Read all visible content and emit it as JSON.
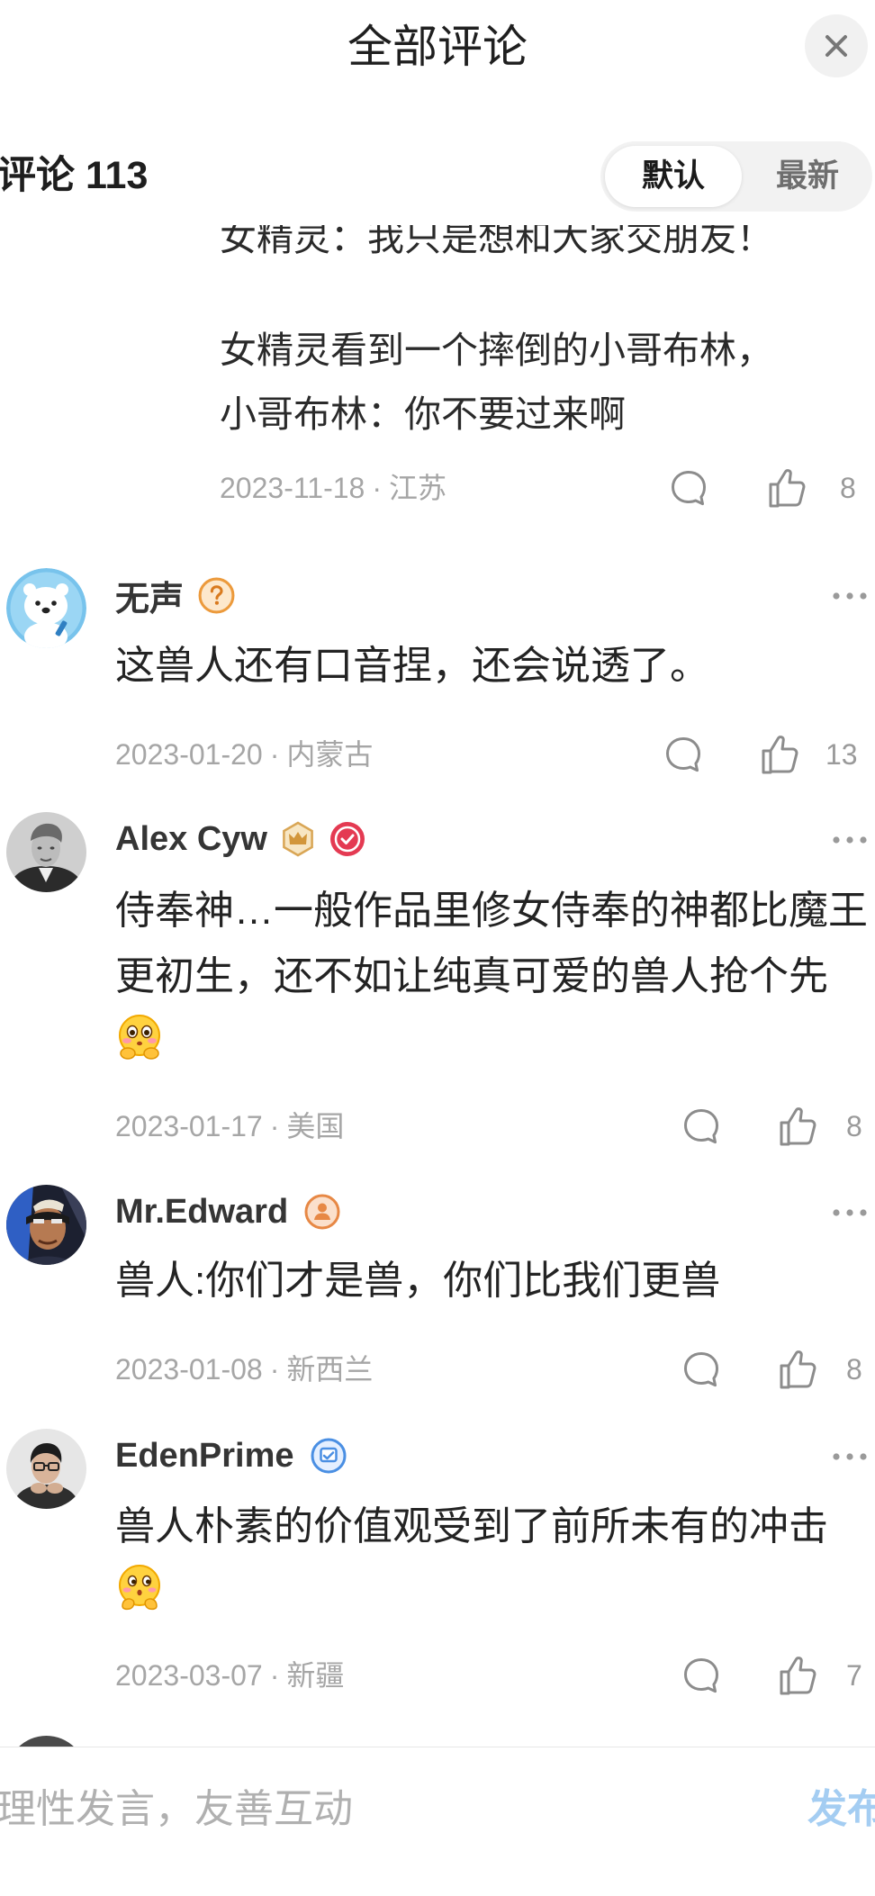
{
  "header": {
    "title": "全部评论",
    "close_icon": "close-icon"
  },
  "comments_bar": {
    "label": "评论",
    "count": "113",
    "sort_options": [
      "默认",
      "最新"
    ],
    "active_sort_index": 0
  },
  "meta_separator": "·",
  "icons": {
    "reply": "comment-bubble-icon",
    "like": "thumbs-up-icon",
    "more": "more-dots-icon"
  },
  "top_reply": {
    "lines": [
      "女精灵：我只是想和大家交朋友！",
      "女精灵看到一个摔倒的小哥布林，",
      "小哥布林：你不要过来啊"
    ],
    "date": "2023-11-18",
    "location": "江苏",
    "likes": "8"
  },
  "comments": [
    {
      "user": "无声",
      "avatar_icon": "polar-bear-avatar",
      "badges": [
        "question-badge-icon"
      ],
      "lines": [
        "这兽人还有口音捏，还会说透了。"
      ],
      "date": "2023-01-20",
      "location": "内蒙古",
      "likes": "13"
    },
    {
      "user": "Alex Cyw",
      "avatar_icon": "portrait-avatar",
      "badges": [
        "crown-badge-icon",
        "verified-check-badge-icon"
      ],
      "lines": [
        "侍奉神…一般作品里修女侍奉的神都比魔王",
        "更初生，还不如让纯真可爱的兽人抢个先"
      ],
      "emoji": "blushing-hands-emoji-icon",
      "date": "2023-01-17",
      "location": "美国",
      "likes": "8"
    },
    {
      "user": "Mr.Edward",
      "avatar_icon": "comic-character-avatar",
      "badges": [
        "creator-badge-icon"
      ],
      "lines": [
        "兽人:你们才是兽，你们比我们更兽"
      ],
      "date": "2023-01-08",
      "location": "新西兰",
      "likes": "8"
    },
    {
      "user": "EdenPrime",
      "avatar_icon": "glasses-person-avatar",
      "badges": [
        "blue-verified-badge-icon"
      ],
      "lines": [
        "兽人朴素的价值观受到了前所未有的冲击"
      ],
      "emoji": "peeking-hands-emoji-icon",
      "date": "2023-03-07",
      "location": "新疆",
      "likes": "7"
    }
  ],
  "footer": {
    "placeholder": "理性发言，友善互动",
    "send_label": "发布"
  },
  "colors": {
    "send_button": "#a4cdf2",
    "meta_text": "#a6a6a6",
    "icon_stroke": "#8c8c8c"
  }
}
